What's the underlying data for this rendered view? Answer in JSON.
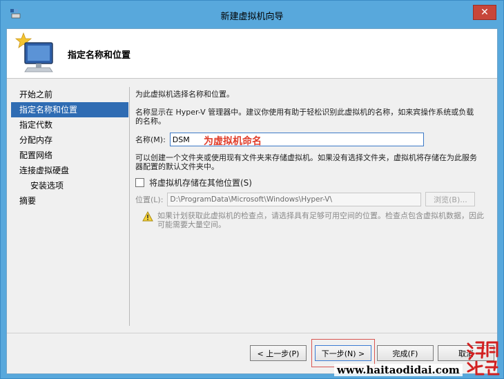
{
  "window": {
    "title": "新建虚拟机向导",
    "close_glyph": "✕"
  },
  "header": {
    "title": "指定名称和位置",
    "icon": "new-vm-monitor-icon"
  },
  "nav": {
    "items": [
      {
        "label": "开始之前",
        "active": false,
        "sub": false
      },
      {
        "label": "指定名称和位置",
        "active": true,
        "sub": false
      },
      {
        "label": "指定代数",
        "active": false,
        "sub": false
      },
      {
        "label": "分配内存",
        "active": false,
        "sub": false
      },
      {
        "label": "配置网络",
        "active": false,
        "sub": false
      },
      {
        "label": "连接虚拟硬盘",
        "active": false,
        "sub": false
      },
      {
        "label": "安装选项",
        "active": false,
        "sub": true
      },
      {
        "label": "摘要",
        "active": false,
        "sub": false
      }
    ]
  },
  "content": {
    "intro": "为此虚拟机选择名称和位置。",
    "name_desc": "名称显示在 Hyper-V 管理器中。建议你使用有助于轻松识别此虚拟机的名称，如来宾操作系统或负载的名称。",
    "name_label": "名称(M):",
    "name_value": "DSM",
    "annotation": "为虚拟机命名",
    "folder_desc": "可以创建一个文件夹或使用现有文件夹来存储虚拟机。如果没有选择文件夹，虚拟机将存储在为此服务器配置的默认文件夹中。",
    "store_checkbox_label": "将虚拟机存储在其他位置(S)",
    "store_checked": false,
    "location_label": "位置(L):",
    "location_value": "D:\\ProgramData\\Microsoft\\Windows\\Hyper-V\\",
    "browse_label": "浏览(B)...",
    "warning": "如果计划获取此虚拟机的检查点，请选择具有足够可用空间的位置。检查点包含虚拟机数据，因此可能需要大量空间。"
  },
  "footer": {
    "prev_label": "< 上一步(P)",
    "next_label": "下一步(N) >",
    "finish_label": "完成(F)",
    "cancel_label": "取消"
  },
  "overlay": {
    "site_text": "www.haitaodidai.com",
    "stamp_text": "海淘地带"
  },
  "colors": {
    "accent": "#2f6cb3",
    "annotation": "#e03d2a",
    "frame": "#58a8dc",
    "close": "#c7463a"
  }
}
